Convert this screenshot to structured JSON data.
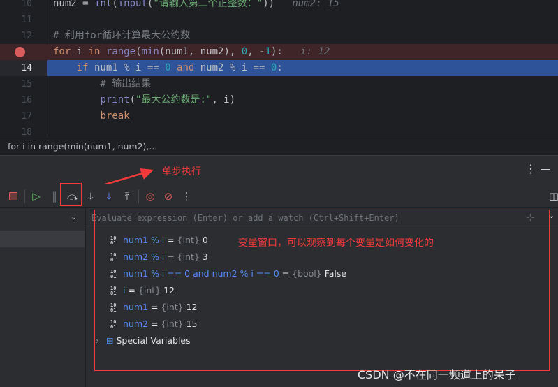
{
  "editor": {
    "lines": [
      {
        "n": "10",
        "parts": [
          [
            "num2 = ",
            ""
          ],
          [
            "int",
            "fn"
          ],
          [
            "(",
            ""
          ],
          [
            "input",
            "fn"
          ],
          [
            "(",
            ""
          ],
          [
            "\"请输入第二个正整数：\"",
            "st"
          ],
          [
            "))",
            ""
          ],
          [
            "   num2: 15",
            "hint"
          ]
        ]
      },
      {
        "n": "11",
        "parts": []
      },
      {
        "n": "12",
        "parts": [
          [
            "# 利用for循环计算最大公约数",
            "cm"
          ]
        ]
      },
      {
        "n": "",
        "breakpoint": true,
        "parts": [
          [
            "for",
            "kw"
          ],
          [
            " i ",
            ""
          ],
          [
            "in",
            "kw"
          ],
          [
            " ",
            ""
          ],
          [
            "range",
            "fn"
          ],
          [
            "(",
            ""
          ],
          [
            "min",
            "fn"
          ],
          [
            "(num1, num2), ",
            ""
          ],
          [
            "0",
            "nu"
          ],
          [
            ", -",
            ""
          ],
          [
            "1",
            "nu"
          ],
          [
            "):",
            ""
          ],
          [
            "   i: 12",
            "hint"
          ]
        ]
      },
      {
        "n": "14",
        "current": true,
        "parts": [
          [
            "    ",
            ""
          ],
          [
            "if",
            "kw"
          ],
          [
            " num1 % i == ",
            ""
          ],
          [
            "0",
            "nu"
          ],
          [
            " ",
            ""
          ],
          [
            "and",
            "kw"
          ],
          [
            " num2 % i == ",
            ""
          ],
          [
            "0",
            "nu"
          ],
          [
            ":",
            ""
          ]
        ]
      },
      {
        "n": "15",
        "parts": [
          [
            "        # 输出结果",
            "cm"
          ]
        ]
      },
      {
        "n": "16",
        "parts": [
          [
            "        ",
            ""
          ],
          [
            "print",
            "fn"
          ],
          [
            "(",
            ""
          ],
          [
            "\"最大公约数是:\"",
            "st"
          ],
          [
            ", i)",
            ""
          ]
        ]
      },
      {
        "n": "17",
        "parts": [
          [
            "        ",
            ""
          ],
          [
            "break",
            "kw"
          ]
        ]
      },
      {
        "n": "18",
        "parts": []
      }
    ]
  },
  "breadcrumb": "for i in range(min(num1, num2),...",
  "annotations": {
    "step": "单步执行",
    "vars": "变量窗口，可以观察到每个变量是如何变化的"
  },
  "eval": {
    "placeholder": "Evaluate expression (Enter) or add a watch (Ctrl+Shift+Enter)"
  },
  "variables": [
    {
      "name": "num1 % i",
      "type": "{int}",
      "value": "0"
    },
    {
      "name": "num2 % i",
      "type": "{int}",
      "value": "3"
    },
    {
      "name": "num1 % i == 0 and num2 % i == 0",
      "type": "{bool}",
      "value": "False"
    },
    {
      "name": "i",
      "type": "{int}",
      "value": "12"
    },
    {
      "name": "num1",
      "type": "{int}",
      "value": "12"
    },
    {
      "name": "num2",
      "type": "{int}",
      "value": "15"
    }
  ],
  "special": "Special Variables",
  "watermark": "CSDN @不在同一频道上的呆子",
  "colors": {
    "accent": "#2e5398",
    "breakpoint": "#db5c5c",
    "annotation": "#f23a3a"
  }
}
